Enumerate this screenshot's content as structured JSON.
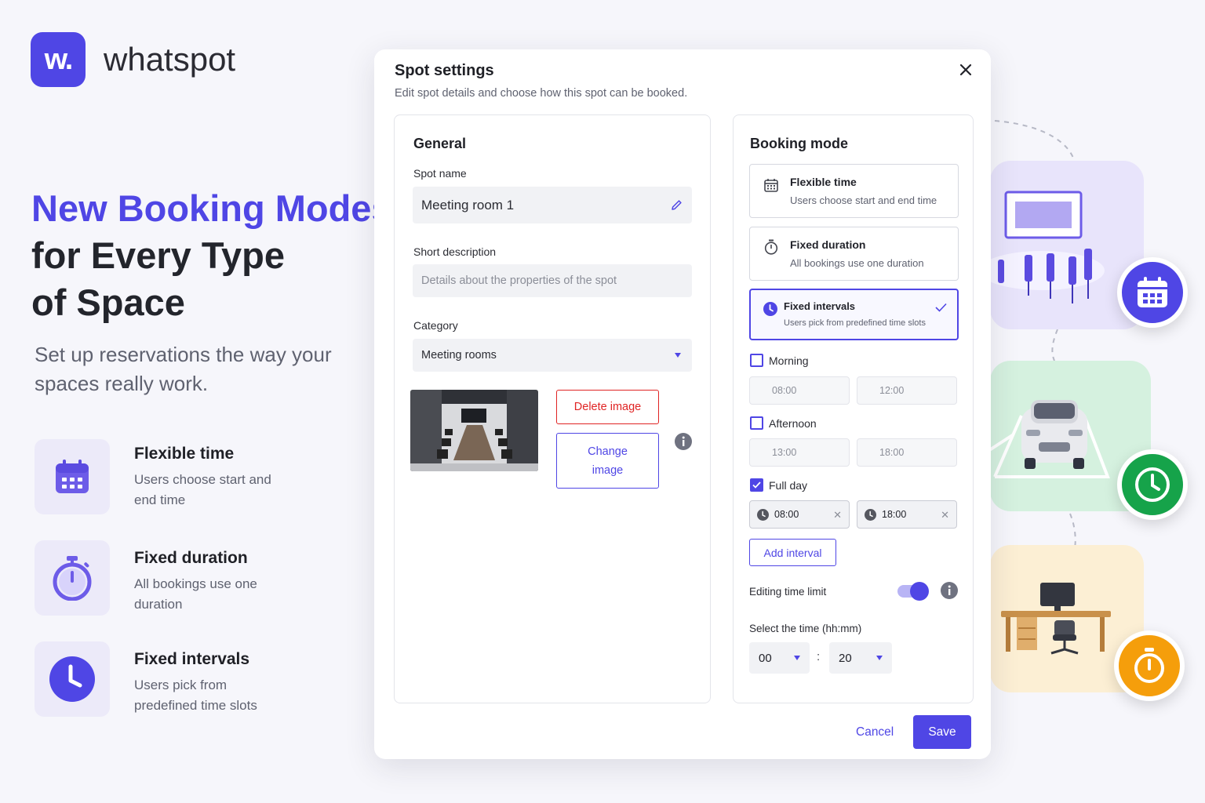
{
  "brand": {
    "logo_mark": "w.",
    "name": "whatspot"
  },
  "hero": {
    "title_accent": "New Booking Modes",
    "title_line2": "for Every Type",
    "title_line3": "of Space",
    "subtitle": "Set up reservations the way your spaces really work."
  },
  "features": [
    {
      "icon": "calendar-icon",
      "title": "Flexible time",
      "desc": "Users choose start and end time"
    },
    {
      "icon": "stopwatch-icon",
      "title": "Fixed duration",
      "desc": "All bookings use one duration"
    },
    {
      "icon": "clock-icon",
      "title": "Fixed intervals",
      "desc": "Users pick from predefined time slots"
    }
  ],
  "modal": {
    "title": "Spot settings",
    "subtitle": "Edit spot details and choose how this spot can be booked.",
    "general": {
      "title": "General",
      "spot_name_label": "Spot name",
      "spot_name_value": "Meeting room 1",
      "short_desc_label": "Short description",
      "short_desc_placeholder": "Details about the properties of the spot",
      "category_label": "Category",
      "category_value": "Meeting rooms",
      "delete_image": "Delete image",
      "change_image": "Change image"
    },
    "booking": {
      "title": "Booking mode",
      "modes": [
        {
          "title": "Flexible time",
          "desc": "Users choose start and end time",
          "selected": false
        },
        {
          "title": "Fixed duration",
          "desc": "All bookings use one duration",
          "selected": false
        },
        {
          "title": "Fixed intervals",
          "desc": "Users pick from predefined time slots",
          "selected": true
        }
      ],
      "intervals": [
        {
          "label": "Morning",
          "checked": false,
          "start": "08:00",
          "end": "12:00"
        },
        {
          "label": "Afternoon",
          "checked": false,
          "start": "13:00",
          "end": "18:00"
        },
        {
          "label": "Full day",
          "checked": true,
          "start": "08:00",
          "end": "18:00"
        }
      ],
      "add_interval": "Add interval",
      "editing_time_limit": "Editing time limit",
      "editing_time_limit_on": true,
      "select_time_label": "Select the time (hh:mm)",
      "hours": "00",
      "minutes": "20",
      "separator": ":"
    },
    "cancel": "Cancel",
    "save": "Save"
  },
  "colors": {
    "accent": "#4f46e5",
    "danger": "#e02424",
    "green": "#16a34a",
    "orange": "#f59e0b"
  }
}
